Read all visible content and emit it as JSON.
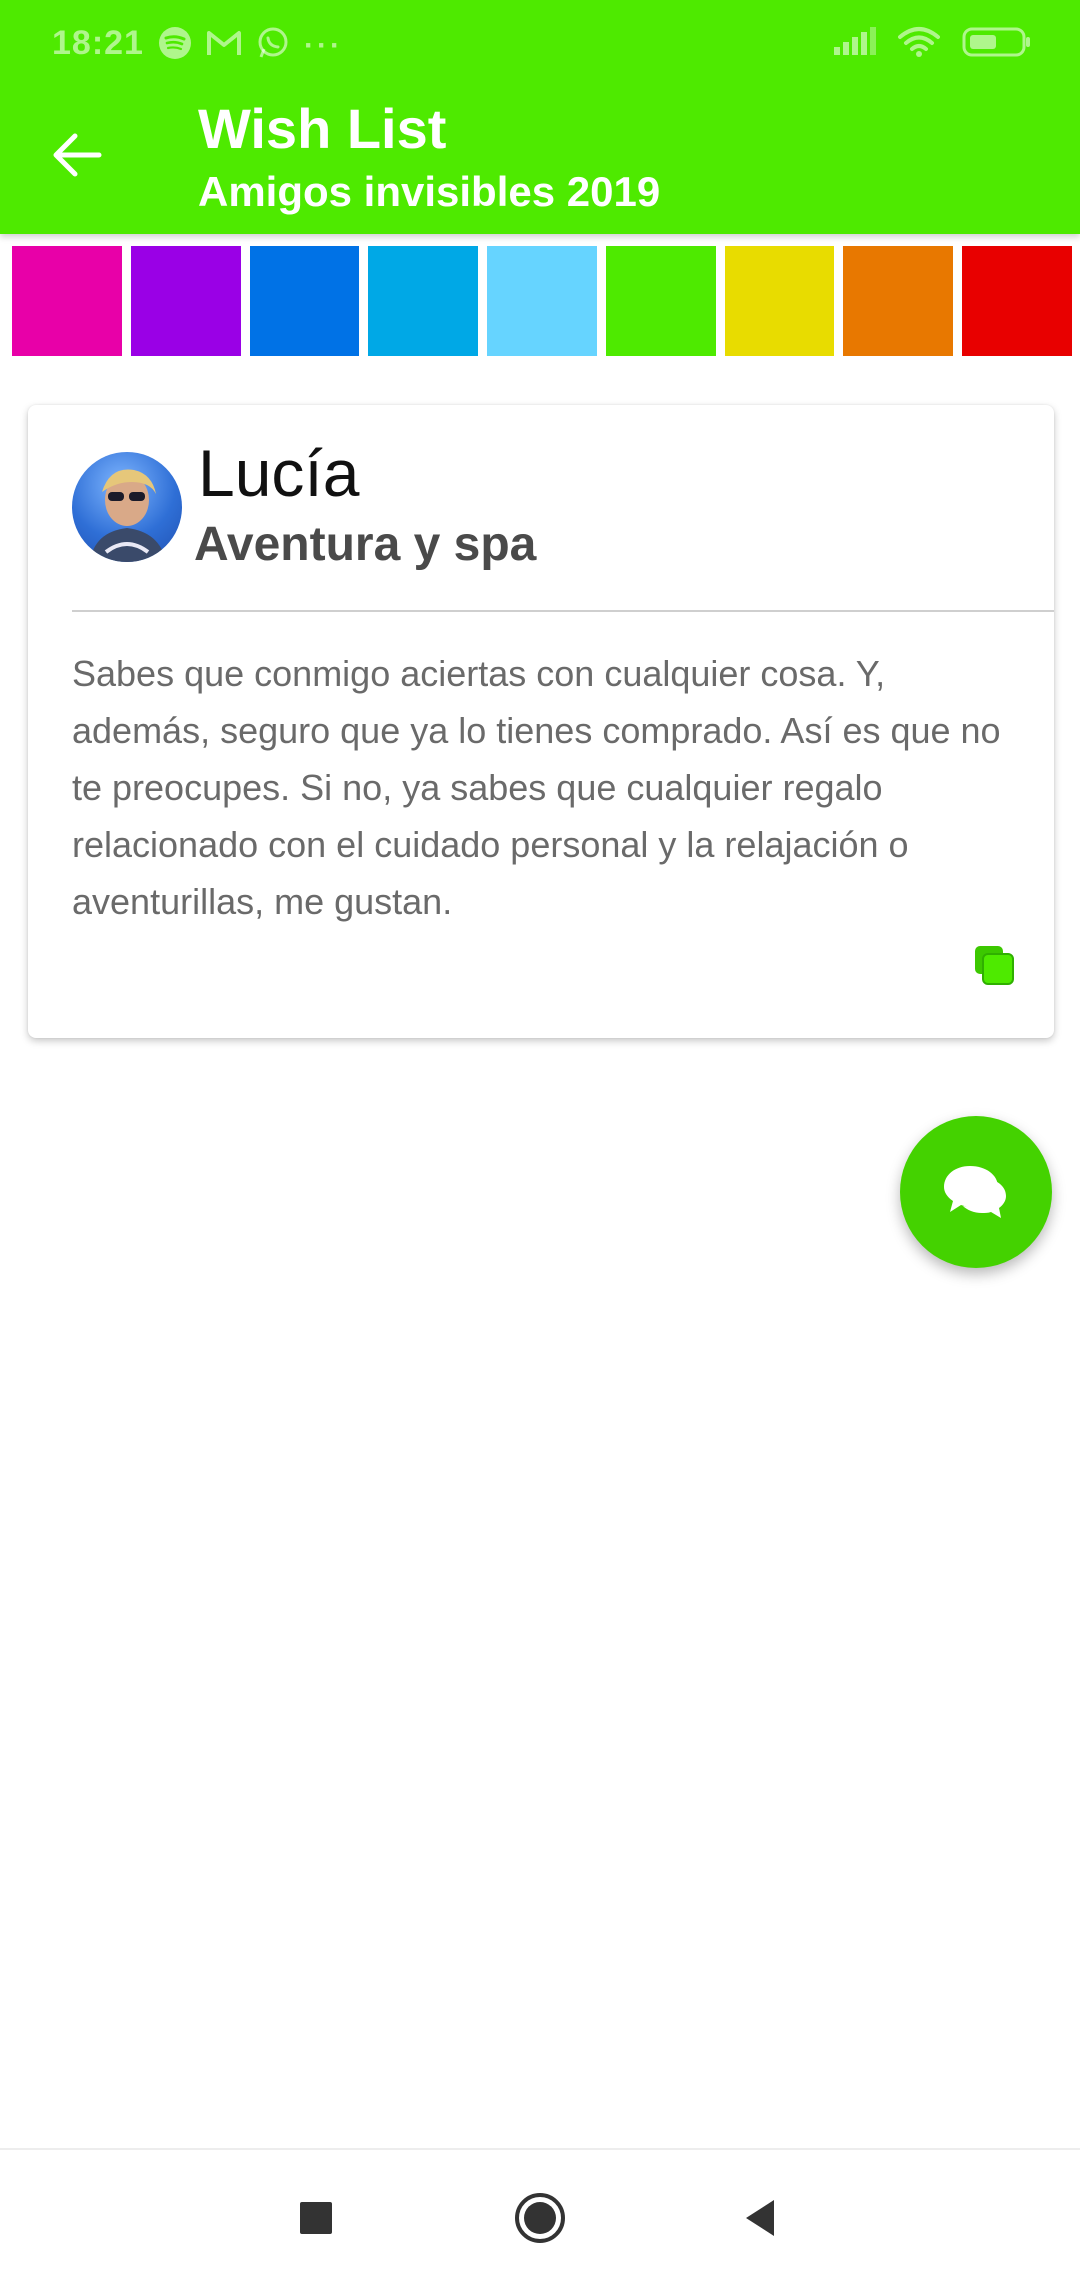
{
  "status_bar": {
    "time": "18:21",
    "notification_icons": [
      "spotify-icon",
      "gmail-icon",
      "whatsapp-icon"
    ],
    "more": "···"
  },
  "app_bar": {
    "title": "Wish List",
    "subtitle": "Amigos invisibles 2019",
    "background_color": "#4eea00"
  },
  "color_swatches": [
    "#e800a8",
    "#9a00e6",
    "#0072e6",
    "#00a8e6",
    "#66d4ff",
    "#4eea00",
    "#e8dc00",
    "#e87800",
    "#e80000"
  ],
  "card": {
    "person_name": "Lucía",
    "wish_title": "Aventura y spa",
    "wish_body": "Sabes que conmigo aciertas con cualquier cosa. Y, además, seguro que ya lo tienes comprado. Así es que no te preocupes. Si no, ya sabes que cualquier regalo relacionado con el cuidado personal y la relajación o aventurillas, me gustan.",
    "copy_icon": "copy-icon"
  },
  "fab": {
    "icon": "chat-icon",
    "color": "#44d200"
  },
  "nav_bar": {
    "buttons": [
      "recents-square-icon",
      "home-circle-icon",
      "back-triangle-icon"
    ]
  }
}
